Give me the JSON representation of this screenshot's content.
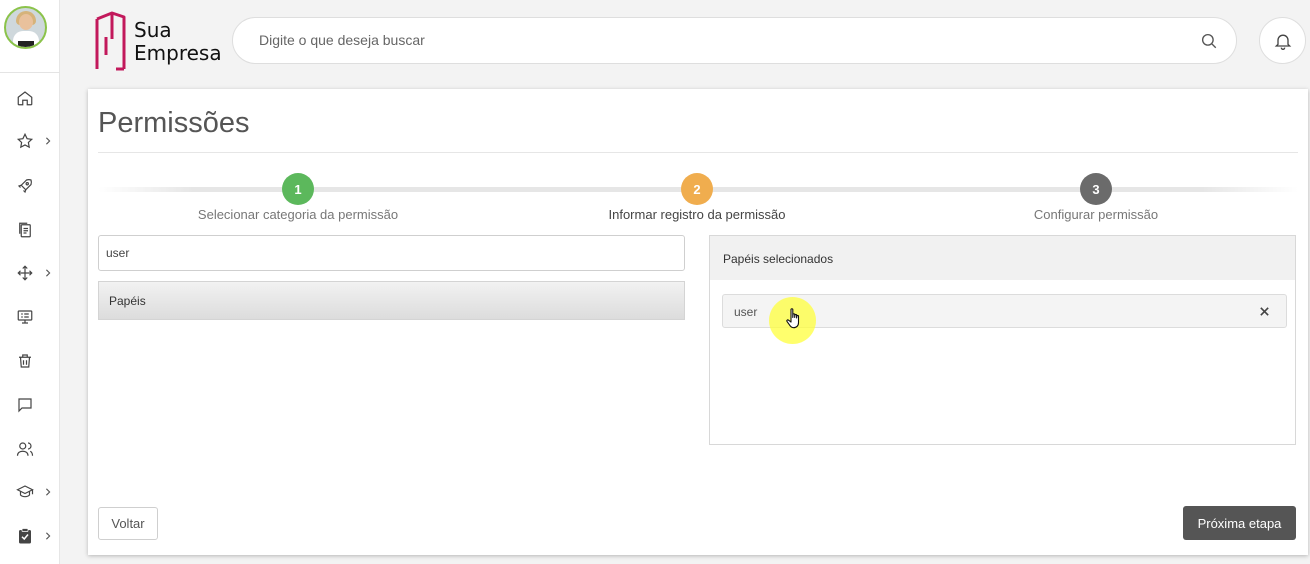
{
  "brand": {
    "line1": "Sua",
    "line2": "Empresa",
    "color": "#c2185b"
  },
  "search": {
    "placeholder": "Digite o que deseja buscar"
  },
  "sidebar": {
    "items": [
      {
        "icon": "home-icon",
        "has_submenu": false
      },
      {
        "icon": "star-icon",
        "has_submenu": true
      },
      {
        "icon": "rocket-icon",
        "has_submenu": false
      },
      {
        "icon": "documents-icon",
        "has_submenu": false
      },
      {
        "icon": "arrows-icon",
        "has_submenu": true
      },
      {
        "icon": "monitor-icon",
        "has_submenu": false
      },
      {
        "icon": "trash-icon",
        "has_submenu": false
      },
      {
        "icon": "chat-icon",
        "has_submenu": false
      },
      {
        "icon": "users-icon",
        "has_submenu": false
      },
      {
        "icon": "graduation-cap-icon",
        "has_submenu": true
      },
      {
        "icon": "clipboard-check-icon",
        "has_submenu": true
      }
    ]
  },
  "page": {
    "title": "Permissões"
  },
  "stepper": {
    "steps": [
      {
        "number": "1",
        "label": "Selecionar categoria da permissão",
        "color": "#5cb85c",
        "state": "done"
      },
      {
        "number": "2",
        "label": "Informar registro da permissão",
        "color": "#f0ad4e",
        "state": "current"
      },
      {
        "number": "3",
        "label": "Configurar permissão",
        "color": "#6b6b6b",
        "state": "pending"
      }
    ]
  },
  "filter": {
    "value": "user"
  },
  "categories": [
    {
      "label": "Papéis"
    }
  ],
  "selected": {
    "title": "Papéis selecionados",
    "items": [
      {
        "label": "user",
        "remove_icon": "close-icon"
      }
    ]
  },
  "actions": {
    "back_label": "Voltar",
    "next_label": "Próxima etapa"
  }
}
